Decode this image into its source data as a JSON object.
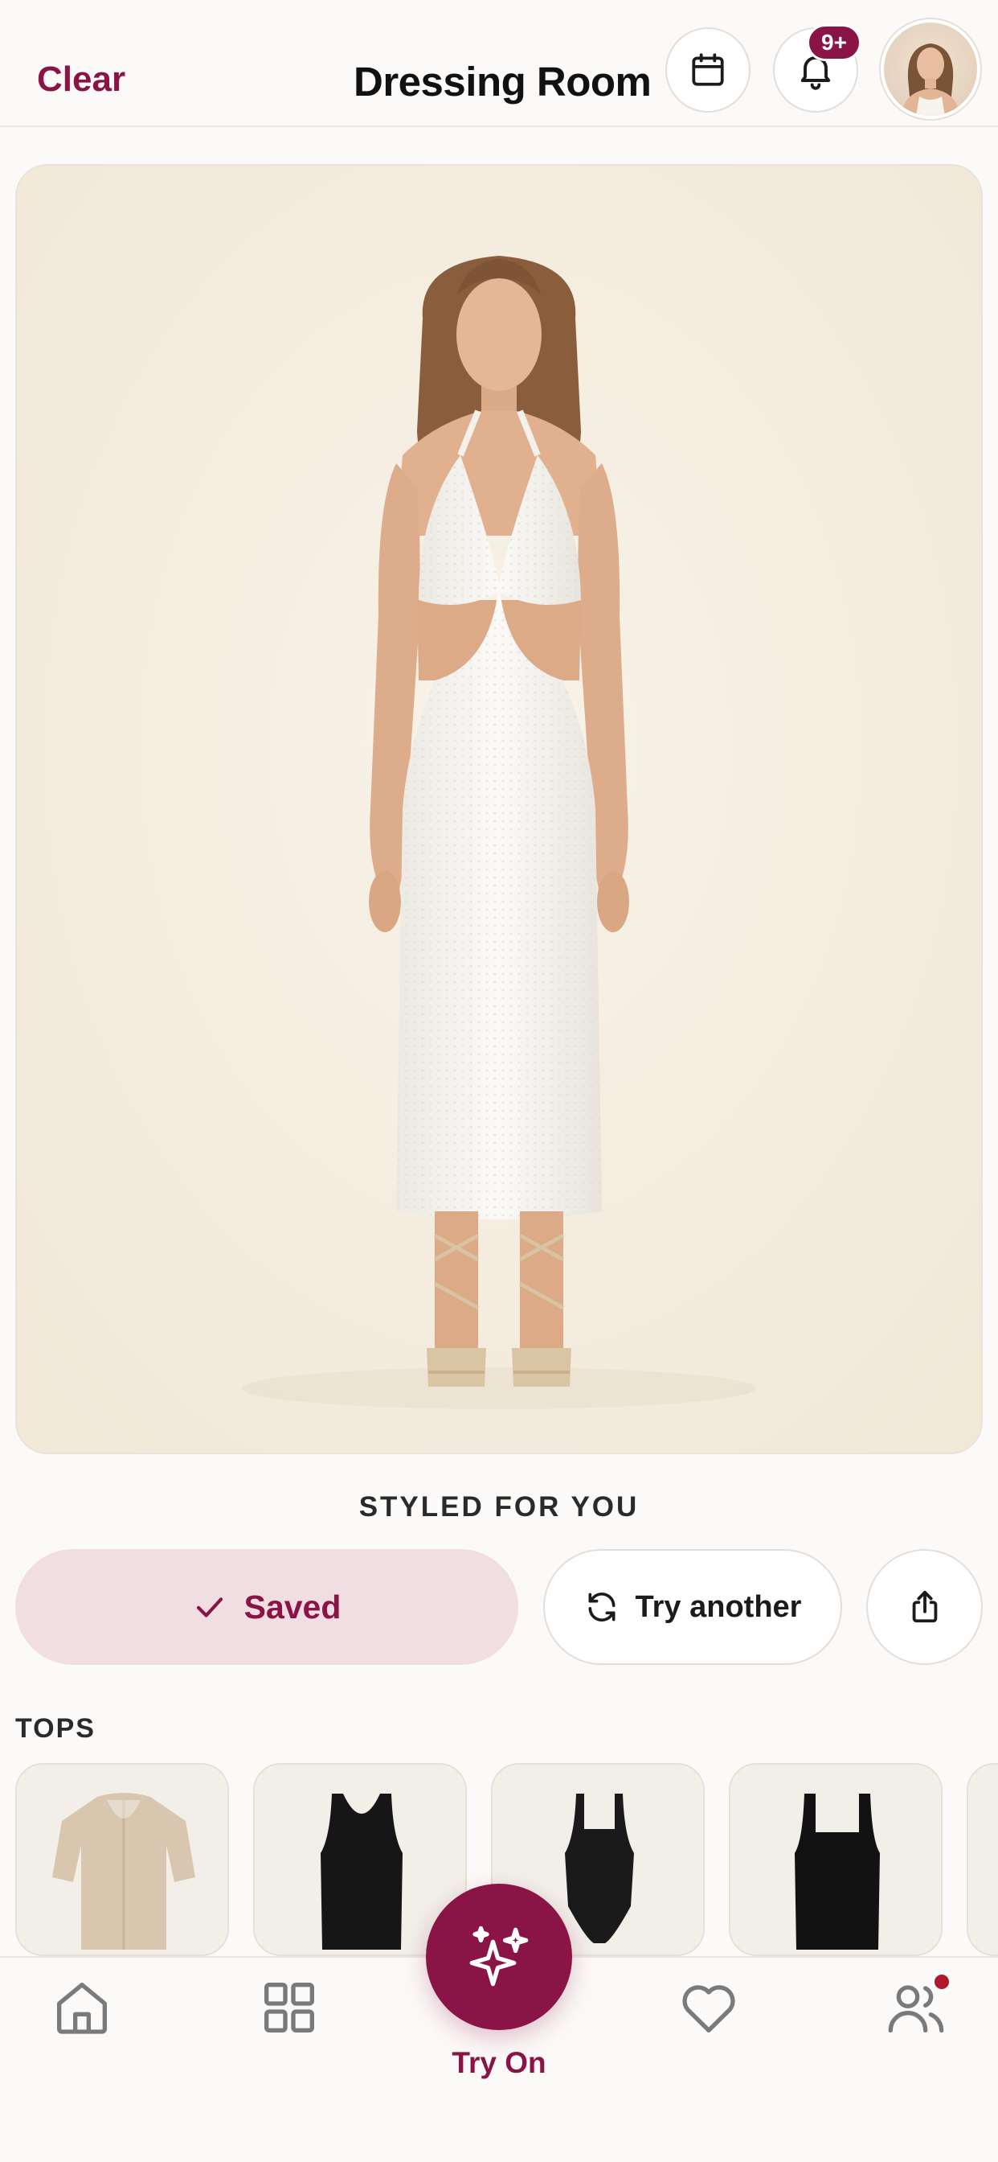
{
  "header": {
    "clear_label": "Clear",
    "title": "Dressing Room",
    "calendar_icon": "calendar-icon",
    "notifications_icon": "bell-icon",
    "notifications_badge": "9+",
    "avatar_icon": "user-avatar"
  },
  "main_photo": {
    "description": "model-wearing-white-knit-cutout-halter-dress"
  },
  "styled": {
    "heading": "STYLED FOR YOU",
    "saved_label": "Saved",
    "try_another_label": "Try another",
    "share_icon": "share-icon"
  },
  "tops": {
    "heading": "TOPS",
    "items": [
      {
        "name": "beige-cardigan"
      },
      {
        "name": "black-tank-top"
      },
      {
        "name": "black-bodysuit"
      },
      {
        "name": "black-square-neck-top"
      }
    ]
  },
  "bottom_nav": {
    "items": [
      "home",
      "wardrobe",
      "try-on",
      "favorites",
      "friends"
    ],
    "try_on_label": "Try On"
  },
  "colors": {
    "accent": "#8B1446",
    "accent_light": "#F1DEE3",
    "background": "#FCFAF8",
    "badge_dot": "#B0182E"
  }
}
